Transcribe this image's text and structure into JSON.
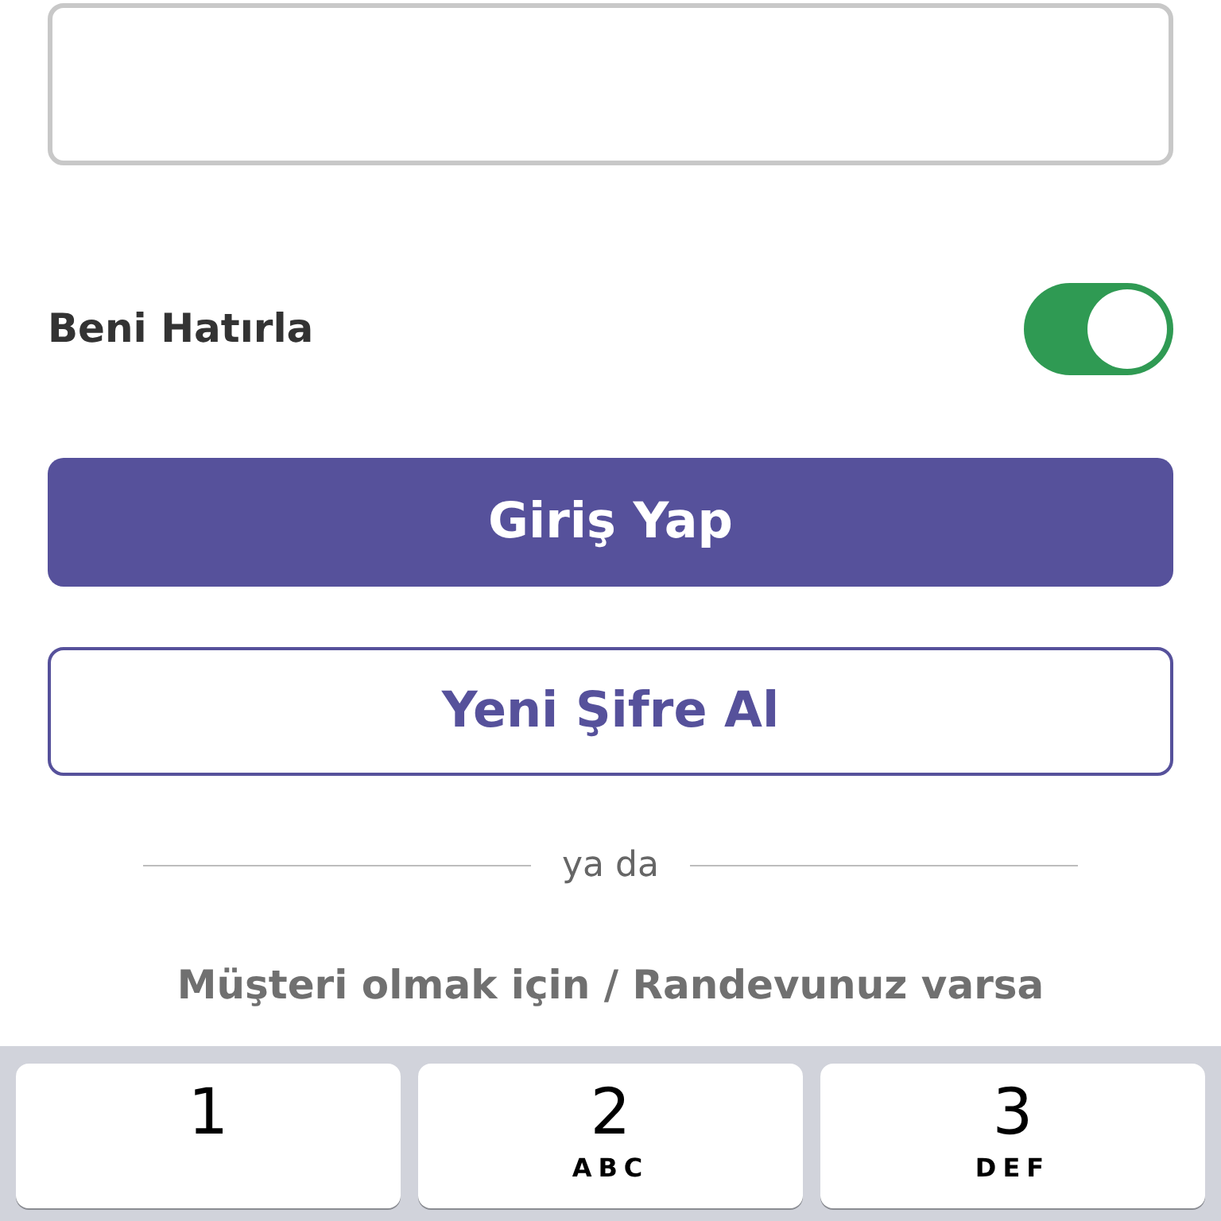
{
  "remember": {
    "label": "Beni Hatırla",
    "on": true
  },
  "login_button": {
    "label": "Giriş Yap"
  },
  "new_password_button": {
    "label": "Yeni Şifre Al"
  },
  "divider": {
    "label": "ya da"
  },
  "customer_text": "Müşteri olmak için / Randevunuz varsa",
  "keypad": [
    {
      "digit": "1"
    },
    {
      "digit": "2",
      "letters": "ABC"
    },
    {
      "digit": "3",
      "letters": "DEF"
    }
  ]
}
